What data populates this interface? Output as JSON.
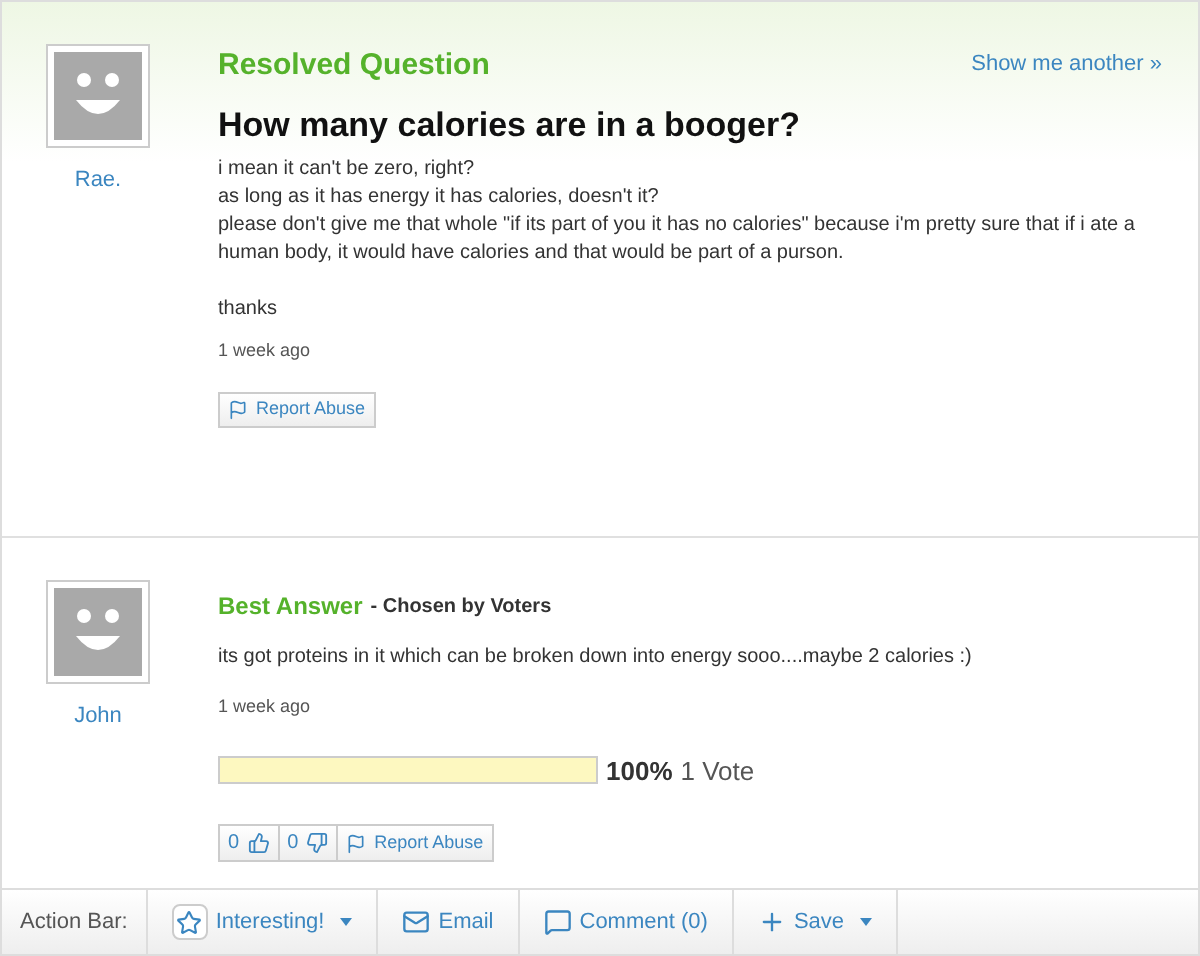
{
  "question": {
    "status": "Resolved Question",
    "show_another": "Show me another »",
    "author": "Rae.",
    "title": "How many calories are in a booger?",
    "body": [
      "i mean it can't be zero, right?",
      "as long as it has energy it has calories, doesn't it?",
      "please don't give me that whole \"if its part of you it has no calories\" because i'm pretty sure that if i ate a human body, it would have calories and that would be part of a purson."
    ],
    "closing": "thanks",
    "time": "1 week ago",
    "report": "Report Abuse"
  },
  "answer": {
    "label": "Best Answer",
    "chosen": "- Chosen by Voters",
    "author": "John",
    "text": "its got proteins in it which can be broken down into energy sooo....maybe 2 calories :)",
    "time": "1 week ago",
    "poll": {
      "level": 1,
      "percent": "100%",
      "votes": "1 Vote"
    },
    "thumbs_up": "0",
    "thumbs_down": "0",
    "report": "Report Abuse"
  },
  "action_bar": {
    "label": "Action Bar:",
    "items": [
      {
        "kind": "star",
        "label": "Interesting!",
        "dropdown": true
      },
      {
        "kind": "email",
        "label": "Email",
        "dropdown": false
      },
      {
        "kind": "comment",
        "label": "Comment (0)",
        "dropdown": false
      },
      {
        "kind": "plus",
        "label": "Save",
        "dropdown": true
      }
    ]
  }
}
